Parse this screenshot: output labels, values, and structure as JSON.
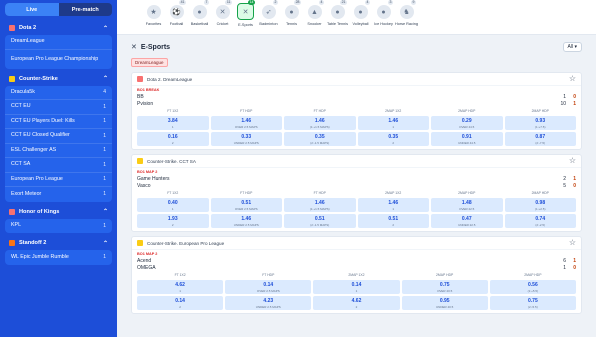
{
  "modes": {
    "live": "Live",
    "prematch": "Pre-match"
  },
  "sidebar": {
    "sections": [
      {
        "title": "Dota 2",
        "color": "#f87171",
        "items": [
          {
            "label": "DreamLeague",
            "count": ""
          },
          {
            "label": "European Pro League Championship",
            "count": "",
            "tall": true
          }
        ]
      },
      {
        "title": "Counter-Strike",
        "color": "#facc15",
        "items": [
          {
            "label": "Dracula5k",
            "count": "4"
          },
          {
            "label": "CCT EU",
            "count": "1"
          },
          {
            "label": "CCT EU Players Duel: Kills",
            "count": "1"
          },
          {
            "label": "CCT EU Closed Qualifier",
            "count": "1"
          },
          {
            "label": "ESL Challenger AS",
            "count": "1"
          },
          {
            "label": "CCT SA",
            "count": "1"
          },
          {
            "label": "European Pro League",
            "count": "1"
          },
          {
            "label": "Exort Meteor",
            "count": "1"
          }
        ]
      },
      {
        "title": "Honor of Kings",
        "color": "#f87171",
        "items": [
          {
            "label": "KPL",
            "count": "1"
          }
        ]
      },
      {
        "title": "Standoff 2",
        "color": "#f97316",
        "items": [
          {
            "label": "WL Epic Jumble Rumble",
            "count": "1"
          }
        ]
      }
    ]
  },
  "sports": [
    {
      "label": "Favorites",
      "icon": "★",
      "count": ""
    },
    {
      "label": "Football",
      "icon": "⚽",
      "count": "41"
    },
    {
      "label": "Basketball",
      "icon": "●",
      "count": "7"
    },
    {
      "label": "Cricket",
      "icon": "✕",
      "count": "11"
    },
    {
      "label": "E-Sports",
      "icon": "✕",
      "count": "14",
      "active": true
    },
    {
      "label": "Badminton",
      "icon": "➶",
      "count": "2"
    },
    {
      "label": "Tennis",
      "icon": "●",
      "count": "28"
    },
    {
      "label": "Snooker",
      "icon": "▲",
      "count": "4"
    },
    {
      "label": "Table Tennis",
      "icon": "●",
      "count": "21"
    },
    {
      "label": "Volleyball",
      "icon": "●",
      "count": "4"
    },
    {
      "label": "Ice Hockey",
      "icon": "●",
      "count": "3"
    },
    {
      "label": "Horse Racing",
      "icon": "♞",
      "count": "9"
    }
  ],
  "section": {
    "title": "E-Sports",
    "filter": "All"
  },
  "chip": "DreamLeague",
  "events": [
    {
      "league": "Dota 2. DreamLeague",
      "logo": "#f87171",
      "status": "BO1 BREAK",
      "teams": [
        {
          "name": "BB",
          "s1": "1",
          "s2": "0"
        },
        {
          "name": "Pvision",
          "s1": "10",
          "s2": "1"
        }
      ],
      "headers": [
        "FT 1X2",
        "FT HDP",
        "FT HDP",
        "2MAP 1X2",
        "2MAP HDP",
        "2MAP HDP"
      ],
      "rows": [
        [
          [
            "3.84",
            "1"
          ],
          [
            "1.46",
            "OVER 2.5 MAPS"
          ],
          [
            "1.46",
            "(1:+1.5 MAPS)"
          ],
          [
            "1.46",
            "1"
          ],
          [
            "0.29",
            "OVER 44.5"
          ],
          [
            "0.93",
            "(1:+7.5)"
          ]
        ],
        [
          [
            "0.16",
            "2"
          ],
          [
            "0.33",
            "UNDER 2.5 MAPS"
          ],
          [
            "0.35",
            "(2:-1.5 MAPS)"
          ],
          [
            "0.35",
            "2"
          ],
          [
            "0.91",
            "UNDER 44.5"
          ],
          [
            "0.87",
            "(2:-7.5)"
          ]
        ]
      ]
    },
    {
      "league": "Counter-Strike. CCT SA",
      "logo": "#facc15",
      "status": "BO1 MAP 2",
      "teams": [
        {
          "name": "Game Hunters",
          "s1": "2",
          "s2": "1"
        },
        {
          "name": "Vasco",
          "s1": "5",
          "s2": "0"
        }
      ],
      "headers": [
        "FT 1X2",
        "FT HDP",
        "FT HDP",
        "2MAP 1X2",
        "2MAP HDP",
        "2MAP HDP"
      ],
      "rows": [
        [
          [
            "0.40",
            "1"
          ],
          [
            "0.51",
            "OVER 2.5 MAPS"
          ],
          [
            "1.46",
            "(1:+1.5 MAPS)"
          ],
          [
            "1.46",
            "1"
          ],
          [
            "1.48",
            "OVER 22.5"
          ],
          [
            "0.98",
            "(1:+2.5)"
          ]
        ],
        [
          [
            "1.93",
            "2"
          ],
          [
            "1.46",
            "UNDER 2.5 MAPS"
          ],
          [
            "0.51",
            "(2:-1.5 MAPS)"
          ],
          [
            "0.51",
            "2"
          ],
          [
            "0.47",
            "UNDER 22.5"
          ],
          [
            "0.74",
            "(2:-2.5)"
          ]
        ]
      ]
    },
    {
      "league": "Counter-Strike. European Pro League",
      "logo": "#facc15",
      "status": "BO1 MAP 2",
      "teams": [
        {
          "name": "Acend",
          "s1": "6",
          "s2": "1"
        },
        {
          "name": "OMEGA",
          "s1": "1",
          "s2": "0"
        }
      ],
      "headers": [
        "FT 1X2",
        "FT HDP",
        "2MAP 1X2",
        "2MAP HDP",
        "2MAP HDP"
      ],
      "rows": [
        [
          [
            "4.62",
            "1"
          ],
          [
            "0.14",
            "OVER 2.5 MAPS"
          ],
          [
            "0.14",
            "1"
          ],
          [
            "0.75",
            "OVER 40.5"
          ],
          [
            "0.56",
            "(1:+5.5)"
          ]
        ],
        [
          [
            "0.14",
            "2"
          ],
          [
            "4.23",
            "UNDER 2.5 MAPS"
          ],
          [
            "4.62",
            "2"
          ],
          [
            "0.95",
            "UNDER 40.5"
          ],
          [
            "0.75",
            "(2:-5.5)"
          ]
        ]
      ]
    }
  ]
}
